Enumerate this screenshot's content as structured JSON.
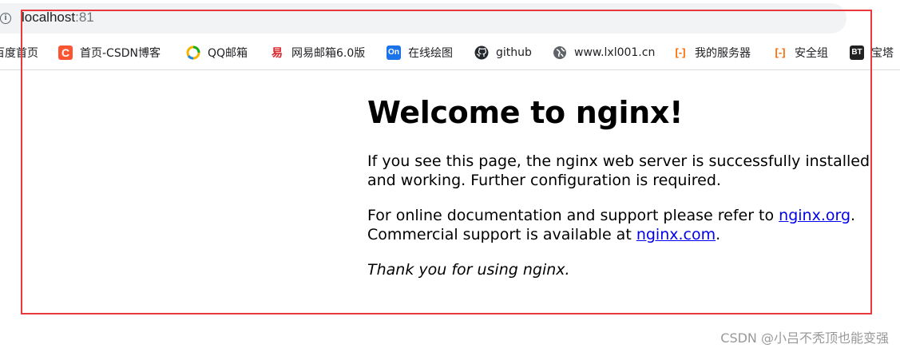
{
  "address_bar": {
    "host": "localhost",
    "port": ":81"
  },
  "bookmarks": [
    {
      "label": "百度首页",
      "icon": "none"
    },
    {
      "label": "首页-CSDN博客",
      "icon": "csdn-icon"
    },
    {
      "label": "QQ邮箱",
      "icon": "qq-mail-icon"
    },
    {
      "label": "网易邮箱6.0版",
      "icon": "netease-mail-icon"
    },
    {
      "label": "在线绘图",
      "icon": "processon-icon"
    },
    {
      "label": "github",
      "icon": "github-icon"
    },
    {
      "label": "www.lxl001.cn",
      "icon": "globe-icon"
    },
    {
      "label": "我的服务器",
      "icon": "aliyun-icon"
    },
    {
      "label": "安全组",
      "icon": "aliyun-icon"
    },
    {
      "label": "宝塔",
      "icon": "bt-icon"
    }
  ],
  "icon_glyphs": {
    "csdn": "C",
    "netease": "易",
    "processon": "On",
    "aliyun": "[-]",
    "bt": "BT",
    "info": "i"
  },
  "colors": {
    "highlight_frame": "#e8383d",
    "link": "#0000ee",
    "csdn": "#fc5531",
    "processon": "#1a73e8"
  },
  "page": {
    "title": "Welcome to nginx!",
    "p1": "If you see this page, the nginx web server is successfully installed and working. Further configuration is required.",
    "p2_before": "For online documentation and support please refer to ",
    "p2_link1": "nginx.org",
    "p2_middle": ".",
    "p2_line2_before": "Commercial support is available at ",
    "p2_link2": "nginx.com",
    "p2_after": ".",
    "p3": "Thank you for using nginx."
  },
  "watermark": "CSDN @小吕不秃顶也能变强"
}
